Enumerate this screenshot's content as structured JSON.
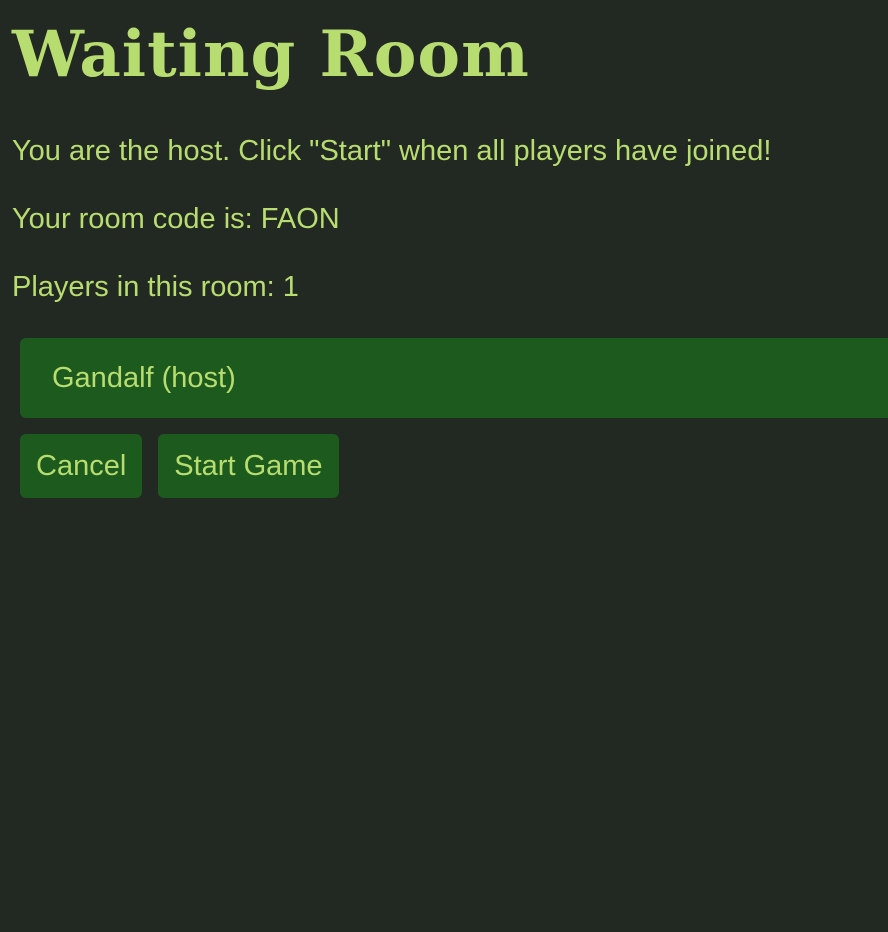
{
  "header": {
    "title": "Waiting Room"
  },
  "info": {
    "host_message": "You are the host. Click \"Start\" when all players have joined!",
    "room_code_text": "Your room code is: FAON",
    "players_count_text": "Players in this room: 1"
  },
  "players": [
    {
      "name": "Gandalf (host)"
    }
  ],
  "actions": {
    "cancel_label": "Cancel",
    "start_label": "Start Game"
  },
  "colors": {
    "background": "#222822",
    "text": "#b7dc6f",
    "accent": "#1d5a1d"
  }
}
